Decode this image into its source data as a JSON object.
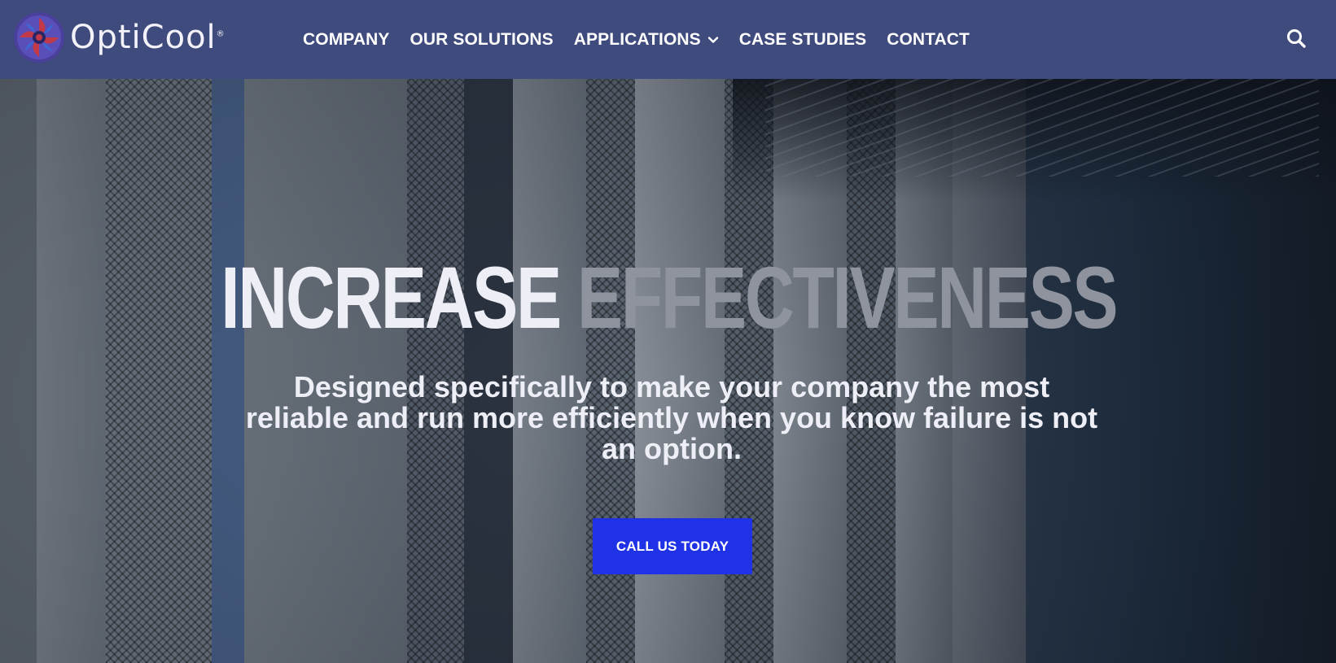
{
  "header": {
    "logo_text": "OptiCool",
    "logo_trademark": "®",
    "nav": [
      {
        "label": "COMPANY"
      },
      {
        "label": "OUR SOLUTIONS"
      },
      {
        "label": "APPLICATIONS",
        "has_dropdown": true
      },
      {
        "label": "CASE STUDIES"
      },
      {
        "label": "CONTACT"
      }
    ],
    "search_icon": "search-icon"
  },
  "hero": {
    "headline_word1": "INCREASE",
    "headline_word2": "EFFECTIVENESS",
    "subtitle": "Designed specifically to make your company the most reliable and run more efficiently when you know failure is not an option.",
    "cta_label": "CALL US TODAY"
  },
  "colors": {
    "header_bg": "#3f4a7d",
    "cta_bg": "#1f32e6",
    "headline_primary": "#eeeef6",
    "headline_secondary": "#8f939d"
  }
}
